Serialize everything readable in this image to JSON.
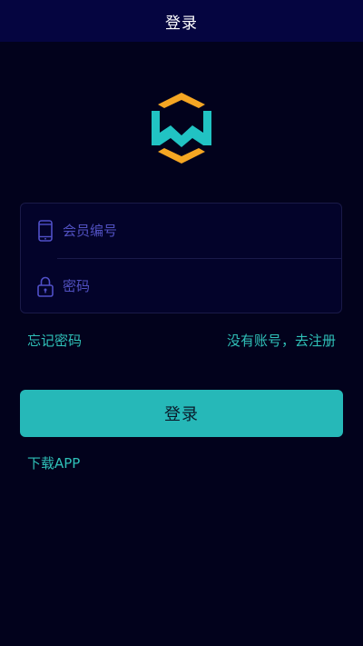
{
  "header": {
    "title": "登录"
  },
  "logo": {
    "icon": "w-hexagon-logo",
    "colors": {
      "teal": "#21c3c3",
      "orange": "#f5a623"
    }
  },
  "form": {
    "member_id": {
      "icon": "phone-icon",
      "placeholder": "会员编号",
      "value": ""
    },
    "password": {
      "icon": "lock-icon",
      "placeholder": "密码",
      "value": ""
    }
  },
  "links": {
    "forgot_password": "忘记密码",
    "register": "没有账号，去注册",
    "download_app": "下载APP"
  },
  "buttons": {
    "login_label": "登录"
  },
  "colors": {
    "background": "#02021c",
    "header_background": "#050540",
    "accent": "#26b8b8",
    "link": "#2fc0b8",
    "placeholder": "#5050c0"
  }
}
